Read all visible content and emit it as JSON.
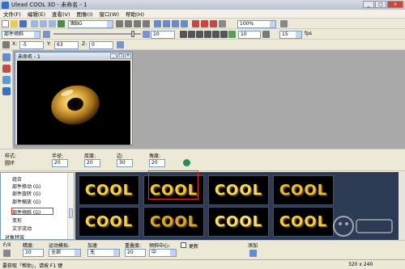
{
  "window": {
    "title": "Ulead COOL 3D - 未命名 - 1",
    "buttons": [
      "_",
      "□",
      "×"
    ]
  },
  "menu": [
    "文件(F)",
    "编辑(E)",
    "查看(V)",
    "图像(I)",
    "窗口(W)",
    "帮助(H)"
  ],
  "toolbar1": {
    "style_select": "图BG",
    "zoom_select": "100%"
  },
  "toolbar2": {
    "style_select": "部件倾斜",
    "frame_value": "10",
    "total_frames": "10",
    "fps_value": "15",
    "fps_label": "fps"
  },
  "toolbar3": {
    "x_label": "X:",
    "x_value": "-5",
    "y_label": "Y:",
    "y_value": "63",
    "z_label": "Z:",
    "z_value": "0"
  },
  "document": {
    "title": "未命名 - 1"
  },
  "properties": {
    "style_label": "样式:",
    "style_value": "圆环",
    "radius_label": "半径:",
    "radius_value": "20",
    "thickness_label": "厚度:",
    "thickness_value": "20",
    "sides_label": "边:",
    "sides_value": "30",
    "angle_label": "角度:",
    "angle_value": "20"
  },
  "tree": {
    "items": [
      "组合",
      "部件移动 (G)",
      "部件旋转 (G)",
      "部件缩放 (G)",
      "部件倾斜 (G)",
      "变形",
      "文字流动"
    ],
    "root": "对象特效",
    "selected_index": 4
  },
  "gallery": {
    "word": "COOL",
    "selected_index": 1,
    "colors": [
      "#f2d04a",
      "#f0c93b",
      "#f6d860",
      "#e8bd3a",
      "#f4d24e",
      "#d8a82a",
      "#f8e070",
      "#f2cc46"
    ]
  },
  "options": {
    "x_label": "F/X",
    "accuracy_label": "精度:",
    "accuracy_value": "10",
    "motion_label": "运动模拟:",
    "motion_value": "全部",
    "accel_label": "加速",
    "accel_value": "无",
    "decel_label": "重叠度:",
    "decel_value": "20",
    "center_label": "倾斜中心:",
    "center_value": "中",
    "checkbox_label": "更新",
    "add_label": "添加"
  },
  "status": {
    "hint": "要获取「帮助」，请按 F1 键",
    "size": "320 x 240"
  }
}
